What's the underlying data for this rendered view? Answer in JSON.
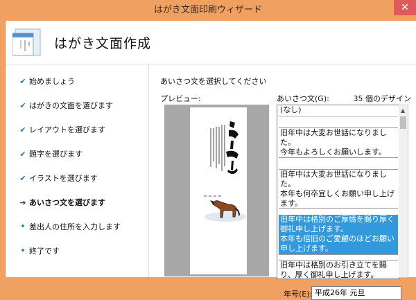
{
  "window": {
    "title": "はがき文面印刷ウィザード",
    "close_label": "✕"
  },
  "header": {
    "title": "はがき文面作成",
    "icon": "postcard-wizard-icon"
  },
  "sidebar": {
    "steps": [
      {
        "label": "始めましょう",
        "marker": "✔",
        "state": "done"
      },
      {
        "label": "はがきの文面を選びます",
        "marker": "✔",
        "state": "done"
      },
      {
        "label": "レイアウトを選びます",
        "marker": "✔",
        "state": "done"
      },
      {
        "label": "題字を選びます",
        "marker": "✔",
        "state": "done"
      },
      {
        "label": "イラストを選びます",
        "marker": "✔",
        "state": "done"
      },
      {
        "label": "あいさつ文を選びます",
        "marker": "➔",
        "state": "current"
      },
      {
        "label": "差出人の住所を入力します",
        "marker": "•",
        "state": "pending"
      },
      {
        "label": "終了です",
        "marker": "•",
        "state": "pending"
      }
    ]
  },
  "main": {
    "instruction": "あいさつ文を選択してください",
    "preview_label": "プレビュー:",
    "greeting_label": "あいさつ文(G):",
    "count_label": "35 個のデザイン",
    "options": [
      {
        "text": "(なし)"
      },
      {
        "text": "旧年中は大変お世話になりました。\n今年もよろしくお願いします。"
      },
      {
        "text": "旧年中は大変お世話になりました。\n本年も何卒宜しくお願い申し上げます。"
      },
      {
        "text": "旧年中は格別のご厚情を賜り厚く御礼申し上げます。\n本年も倍旧のご愛顧のほどお願い申し上げます。",
        "selected": true
      },
      {
        "text": "旧年中は格別のお引き立てを賜り、厚く御礼申し上げます。\n本年も倍旧のご指導のほど、お"
      }
    ],
    "era_label": "年号(E):",
    "era_value": "平成26年 元旦"
  },
  "colors": {
    "titlebar": "#f0a060",
    "selection": "#3399dd",
    "check": "#2a6fb0",
    "close": "#e15a5a"
  }
}
